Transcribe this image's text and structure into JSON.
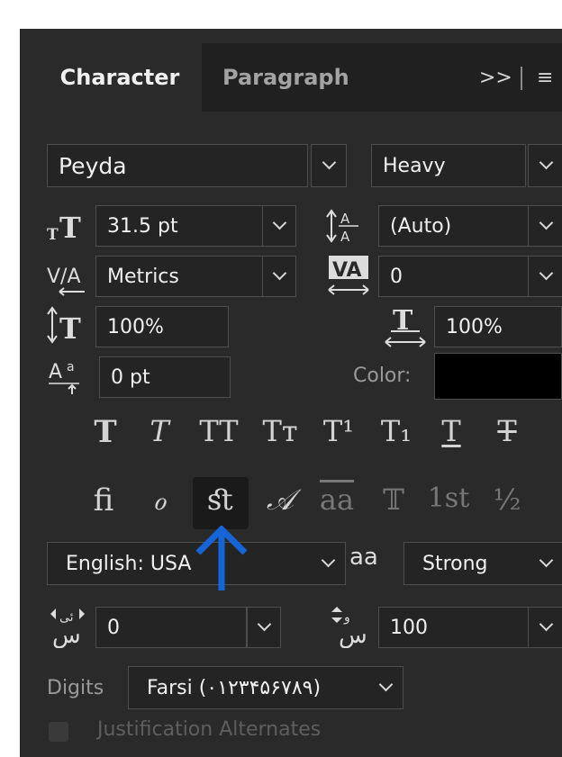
{
  "tabs": [
    {
      "label": "Character",
      "active": true
    },
    {
      "label": "Paragraph",
      "active": false
    }
  ],
  "tab_controls": {
    "expand_icon": "double-chevron-right-icon",
    "expand_label": ">>",
    "menu_icon": "hamburger-menu-icon",
    "menu_label": "≡"
  },
  "font": {
    "family": "Peyda",
    "style": "Heavy"
  },
  "size": {
    "value": "31.5 pt",
    "icon": "font-size-icon"
  },
  "leading": {
    "value": "(Auto)",
    "icon": "leading-icon"
  },
  "kerning": {
    "value": "Metrics",
    "icon": "kerning-icon"
  },
  "tracking": {
    "value": "0",
    "icon": "tracking-icon"
  },
  "vertical_scale": {
    "value": "100%",
    "icon": "vertical-scale-icon"
  },
  "horizontal_scale": {
    "value": "100%",
    "icon": "horizontal-scale-icon"
  },
  "baseline_shift": {
    "value": "0 pt",
    "icon": "baseline-shift-icon"
  },
  "color": {
    "label": "Color:",
    "value": "#000000"
  },
  "style_buttons": [
    {
      "name": "faux-bold-icon",
      "glyph": "T"
    },
    {
      "name": "faux-italic-icon",
      "glyph": "T"
    },
    {
      "name": "all-caps-icon",
      "glyph": "TT"
    },
    {
      "name": "small-caps-icon",
      "glyph": "Tт"
    },
    {
      "name": "superscript-icon",
      "glyph": "T¹"
    },
    {
      "name": "subscript-icon",
      "glyph": "T₁"
    },
    {
      "name": "underline-icon",
      "glyph": "T"
    },
    {
      "name": "strikethrough-icon",
      "glyph": "T"
    }
  ],
  "opentype_buttons": [
    {
      "name": "standard-ligatures-icon",
      "glyph": "fi",
      "enabled": true
    },
    {
      "name": "contextual-alternates-icon",
      "glyph": "ℴ",
      "enabled": true
    },
    {
      "name": "discretionary-ligatures-icon",
      "glyph": "ﬆ",
      "enabled": true,
      "selected": true
    },
    {
      "name": "swash-icon",
      "glyph": "𝒜",
      "enabled": true
    },
    {
      "name": "stylistic-alternates-icon",
      "glyph": "aa",
      "enabled": false
    },
    {
      "name": "titling-alternates-icon",
      "glyph": "𝕋",
      "enabled": false
    },
    {
      "name": "ordinals-icon",
      "glyph": "1st",
      "enabled": false
    },
    {
      "name": "fractions-icon",
      "glyph": "½",
      "enabled": false
    }
  ],
  "language": {
    "value": "English: USA"
  },
  "antialias": {
    "value": "Strong",
    "icon": "antialiasing-icon",
    "icon_text": "aa"
  },
  "arabic_kashida": {
    "value": "0",
    "icon": "kashida-icon"
  },
  "arabic_diacritics": {
    "value": "100",
    "icon": "diacritic-position-icon"
  },
  "digits": {
    "label": "Digits",
    "value": "Farsi (۰۱۲۳۴۵۶۷۸۹)"
  },
  "justification": {
    "label": "Justification Alternates",
    "checked": false
  },
  "annotation": {
    "arrow_color": "#1565d8",
    "arrow_icon": "arrow-up-icon"
  }
}
